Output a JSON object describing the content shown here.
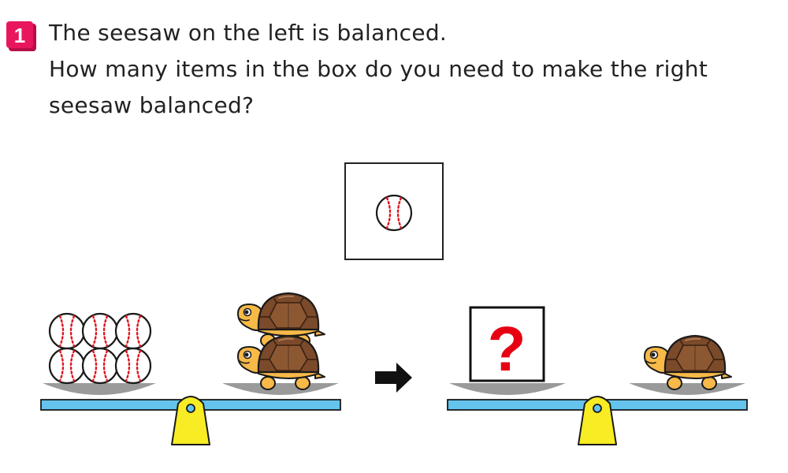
{
  "question": {
    "number": "1",
    "lines": [
      "The seesaw on the left is balanced.",
      "How many items in the box do you need to make the right",
      "seesaw balanced?"
    ]
  },
  "item_box": {
    "item": "baseball-icon",
    "count": 1
  },
  "left_seesaw": {
    "left_pan": {
      "item": "baseball-icon",
      "count": 6
    },
    "right_pan": {
      "item": "turtle-icon",
      "count": 2
    },
    "state": "balanced"
  },
  "arrow": {
    "icon": "arrow-right-icon"
  },
  "right_seesaw": {
    "left_pan": {
      "unknown_box_text": "?"
    },
    "right_pan": {
      "item": "turtle-icon",
      "count": 1
    }
  },
  "colors": {
    "badge": "#e8175d",
    "beam": "#64c4ee",
    "fulcrum": "#f8ec24",
    "pan": "#9a9a9a",
    "question_mark": "#e60012",
    "ball_stitch": "#e0141e",
    "turtle_body": "#f7b948",
    "turtle_shell": "#7a4a2b"
  }
}
